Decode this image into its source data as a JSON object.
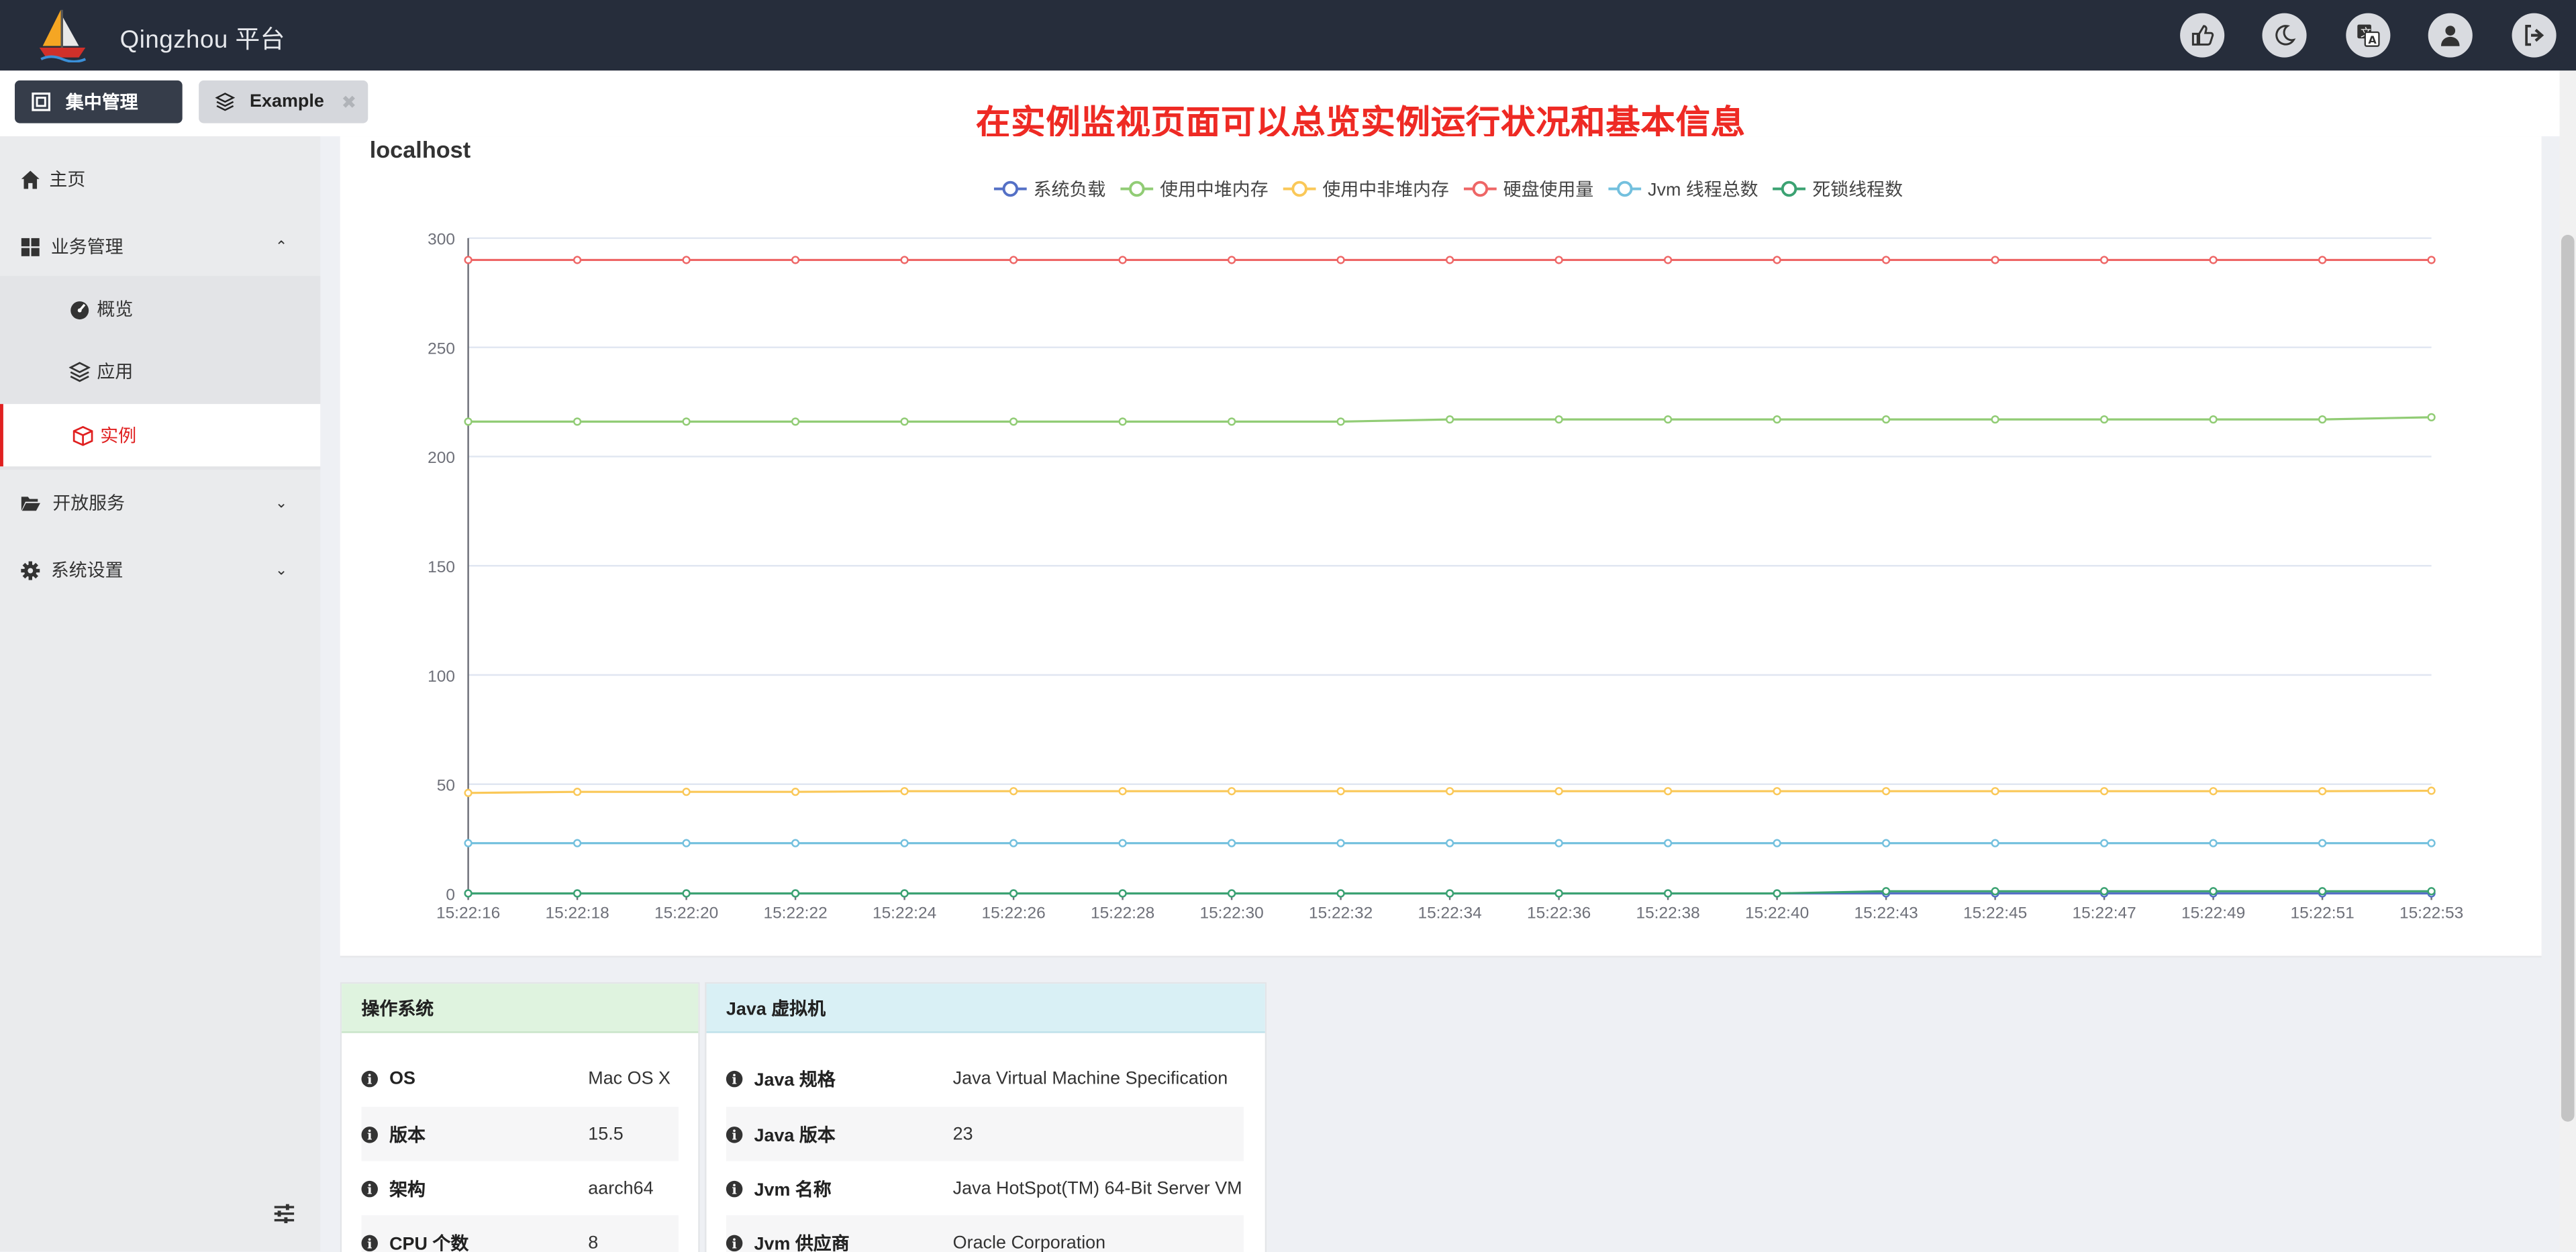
{
  "app": {
    "title": "Qingzhou 平台"
  },
  "header_icons": [
    "thumbs-up-icon",
    "moon-icon",
    "translate-icon",
    "user-icon",
    "sign-out-icon"
  ],
  "tabs": [
    {
      "label": "集中管理",
      "active": true,
      "icon": "server-icon"
    },
    {
      "label": "Example",
      "active": false,
      "icon": "layers-icon",
      "close": "✖"
    }
  ],
  "banner": "在实例监视页面可以总览实例运行状况和基本信息",
  "sidebar": {
    "items": [
      {
        "label": "主页",
        "icon": "home-icon"
      },
      {
        "label": "业务管理",
        "icon": "grid-icon",
        "expanded": true
      },
      {
        "label": "概览",
        "icon": "dashboard-icon"
      },
      {
        "label": "应用",
        "icon": "layers-icon"
      },
      {
        "label": "实例",
        "icon": "cube-icon",
        "active": true
      },
      {
        "label": "开放服务",
        "icon": "folder-open-icon"
      },
      {
        "label": "系统设置",
        "icon": "gear-icon"
      }
    ]
  },
  "host": "localhost",
  "chart_data": {
    "type": "line",
    "x": [
      "15:22:16",
      "15:22:18",
      "15:22:20",
      "15:22:22",
      "15:22:24",
      "15:22:26",
      "15:22:28",
      "15:22:30",
      "15:22:32",
      "15:22:34",
      "15:22:36",
      "15:22:38",
      "15:22:40",
      "15:22:43",
      "15:22:45",
      "15:22:47",
      "15:22:49",
      "15:22:51",
      "15:22:53"
    ],
    "ylim": [
      0,
      300
    ],
    "yticks": [
      0,
      50,
      100,
      150,
      200,
      250,
      300
    ],
    "grid": true,
    "legend_position": "top-center",
    "series": [
      {
        "name": "系统负载",
        "color": "#5470c6",
        "values": [
          0,
          0,
          0,
          0,
          0,
          0,
          0,
          0,
          0,
          0,
          0,
          0,
          0,
          0,
          0,
          0,
          0,
          0,
          0
        ]
      },
      {
        "name": "使用中堆内存",
        "color": "#91cc75",
        "values": [
          216,
          216,
          216,
          216,
          216,
          216,
          216,
          216,
          216,
          217,
          217,
          217,
          217,
          217,
          217,
          217,
          217,
          217,
          218
        ]
      },
      {
        "name": "使用中非堆内存",
        "color": "#fac858",
        "values": [
          46,
          46.5,
          46.5,
          46.5,
          46.8,
          46.8,
          46.8,
          46.8,
          46.8,
          46.8,
          46.8,
          46.8,
          46.8,
          46.8,
          46.8,
          46.8,
          46.8,
          46.8,
          47
        ]
      },
      {
        "name": "硬盘使用量",
        "color": "#ee6666",
        "values": [
          290,
          290,
          290,
          290,
          290,
          290,
          290,
          290,
          290,
          290,
          290,
          290,
          290,
          290,
          290,
          290,
          290,
          290,
          290
        ]
      },
      {
        "name": "Jvm 线程总数",
        "color": "#73c0de",
        "values": [
          23,
          23,
          23,
          23,
          23,
          23,
          23,
          23,
          23,
          23,
          23,
          23,
          23,
          23,
          23,
          23,
          23,
          23,
          23
        ]
      },
      {
        "name": "死锁线程数",
        "color": "#3ba272",
        "values": [
          0,
          0,
          0,
          0,
          0,
          0,
          0,
          0,
          0,
          0,
          0,
          0,
          0,
          1,
          1,
          1,
          1,
          1,
          1
        ]
      }
    ]
  },
  "os_card": {
    "title": "操作系统",
    "rows": [
      {
        "key": "OS",
        "value": "Mac OS X"
      },
      {
        "key": "版本",
        "value": "15.5"
      },
      {
        "key": "架构",
        "value": "aarch64"
      },
      {
        "key": "CPU 个数",
        "value": "8"
      }
    ]
  },
  "jvm_card": {
    "title": "Java 虚拟机",
    "rows": [
      {
        "key": "Java 规格",
        "value": "Java Virtual Machine Specification"
      },
      {
        "key": "Java 版本",
        "value": "23"
      },
      {
        "key": "Jvm 名称",
        "value": "Java HotSpot(TM) 64-Bit Server VM"
      },
      {
        "key": "Jvm 供应商",
        "value": "Oracle Corporation"
      }
    ]
  },
  "colors": {
    "topbar": "#262d3b",
    "banner": "#ee2a24",
    "active_accent": "#e02020",
    "os_header": "#dff3df",
    "jvm_header": "#d9f0f5"
  }
}
